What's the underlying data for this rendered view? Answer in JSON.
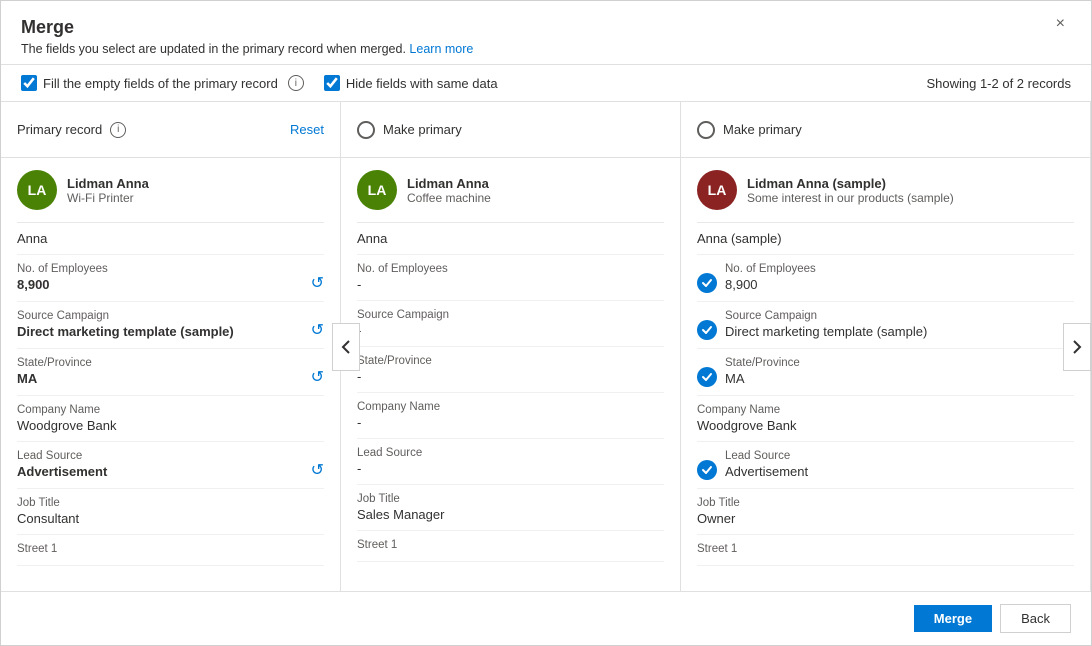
{
  "dialog": {
    "title": "Merge",
    "subtitle": "The fields you select are updated in the primary record when merged.",
    "learn_more": "Learn more",
    "close_label": "×"
  },
  "options": {
    "fill_empty": "Fill the empty fields of the primary record",
    "hide_same": "Hide fields with same data",
    "records_count": "Showing 1-2 of 2 records"
  },
  "columns": [
    {
      "id": "primary",
      "header_label": "Primary record",
      "show_reset": true,
      "reset_label": "Reset",
      "show_radio": false,
      "avatar_initials": "LA",
      "avatar_color": "green",
      "record_name": "Lidman Anna",
      "record_sub": "Wi-Fi Printer",
      "first_name": "Anna",
      "fields": [
        {
          "label": "No. of Employees",
          "value": "8,900",
          "bold": true,
          "has_reset": true,
          "has_check": false
        },
        {
          "label": "Source Campaign",
          "value": "Direct marketing template (sample)",
          "bold": true,
          "has_reset": true,
          "has_check": false
        },
        {
          "label": "State/Province",
          "value": "MA",
          "bold": true,
          "has_reset": true,
          "has_check": false
        },
        {
          "label": "Company Name",
          "value": "Woodgrove Bank",
          "bold": false,
          "has_reset": false,
          "has_check": false
        },
        {
          "label": "Lead Source",
          "value": "Advertisement",
          "bold": true,
          "has_reset": true,
          "has_check": false
        },
        {
          "label": "Job Title",
          "value": "Consultant",
          "bold": false,
          "has_reset": false,
          "has_check": false
        },
        {
          "label": "Street 1",
          "value": "",
          "bold": false,
          "has_reset": false,
          "has_check": false
        }
      ]
    },
    {
      "id": "secondary1",
      "header_label": "Make primary",
      "show_reset": false,
      "reset_label": "",
      "show_radio": true,
      "avatar_initials": "LA",
      "avatar_color": "green",
      "record_name": "Lidman Anna",
      "record_sub": "Coffee machine",
      "first_name": "Anna",
      "fields": [
        {
          "label": "No. of Employees",
          "value": "-",
          "bold": false,
          "has_reset": false,
          "has_check": false
        },
        {
          "label": "Source Campaign",
          "value": "-",
          "bold": false,
          "has_reset": false,
          "has_check": false
        },
        {
          "label": "State/Province",
          "value": "-",
          "bold": false,
          "has_reset": false,
          "has_check": false
        },
        {
          "label": "Company Name",
          "value": "-",
          "bold": false,
          "has_reset": false,
          "has_check": false
        },
        {
          "label": "Lead Source",
          "value": "-",
          "bold": false,
          "has_reset": false,
          "has_check": false
        },
        {
          "label": "Job Title",
          "value": "Sales Manager",
          "bold": false,
          "has_reset": false,
          "has_check": false
        },
        {
          "label": "Street 1",
          "value": "",
          "bold": false,
          "has_reset": false,
          "has_check": false
        }
      ]
    },
    {
      "id": "secondary2",
      "header_label": "Make primary",
      "show_reset": false,
      "reset_label": "",
      "show_radio": true,
      "avatar_initials": "LA",
      "avatar_color": "dark-red",
      "record_name": "Lidman Anna (sample)",
      "record_sub": "Some interest in our products (sample)",
      "first_name": "Anna (sample)",
      "fields": [
        {
          "label": "No. of Employees",
          "value": "8,900",
          "bold": false,
          "has_reset": false,
          "has_check": true
        },
        {
          "label": "Source Campaign",
          "value": "Direct marketing template (sample)",
          "bold": false,
          "has_reset": false,
          "has_check": true
        },
        {
          "label": "State/Province",
          "value": "MA",
          "bold": false,
          "has_reset": false,
          "has_check": true
        },
        {
          "label": "Company Name",
          "value": "Woodgrove Bank",
          "bold": false,
          "has_reset": false,
          "has_check": false
        },
        {
          "label": "Lead Source",
          "value": "Advertisement",
          "bold": false,
          "has_reset": false,
          "has_check": true
        },
        {
          "label": "Job Title",
          "value": "Owner",
          "bold": false,
          "has_reset": false,
          "has_check": false
        },
        {
          "label": "Street 1",
          "value": "",
          "bold": false,
          "has_reset": false,
          "has_check": false
        }
      ]
    }
  ],
  "footer": {
    "merge_label": "Merge",
    "back_label": "Back"
  }
}
